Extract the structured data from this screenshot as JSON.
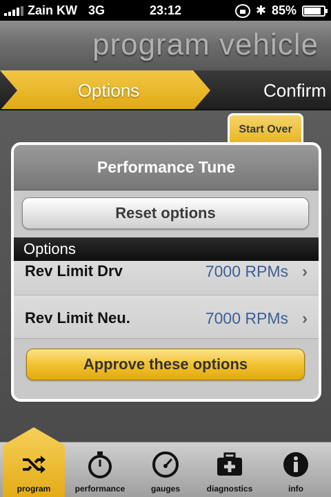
{
  "status_bar": {
    "carrier": "Zain KW",
    "network": "3G",
    "time": "23:12",
    "battery": "85%"
  },
  "header": {
    "title": "program vehicle"
  },
  "steps": {
    "current": "Options",
    "next": "Confirm"
  },
  "start_over_label": "Start Over",
  "panel": {
    "title": "Performance Tune",
    "reset_label": "Reset options",
    "section_label": "Options",
    "rows": [
      {
        "label": "Rev Limit Drv",
        "value": "7000 RPMs"
      },
      {
        "label": "Rev Limit Neu.",
        "value": "7000 RPMs"
      }
    ],
    "approve_label": "Approve these options"
  },
  "tabs": [
    {
      "label": "program",
      "icon": "shuffle-icon",
      "active": true
    },
    {
      "label": "performance",
      "icon": "stopwatch-icon",
      "active": false
    },
    {
      "label": "gauges",
      "icon": "gauge-icon",
      "active": false
    },
    {
      "label": "diagnostics",
      "icon": "first-aid-kit-icon",
      "active": false
    },
    {
      "label": "info",
      "icon": "info-icon",
      "active": false
    }
  ],
  "colors": {
    "accent_yellow": "#f2c233",
    "value_blue": "#3d5f97",
    "dark_bar": "#1e1e1e"
  }
}
